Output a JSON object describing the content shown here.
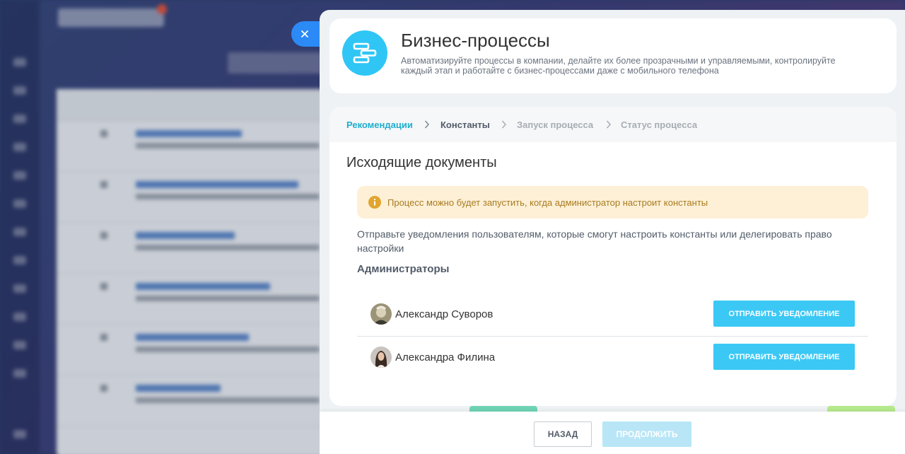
{
  "header": {
    "title": "Бизнес-процессы",
    "description": "Автоматизируйте процессы в компании, делайте их более прозрачными и управляемыми, контролируйте каждый этап и работайте с бизнес-процессами даже с мобильного телефона",
    "icon": "business-process-icon",
    "accent_color": "#2fc6f6"
  },
  "steps": [
    {
      "label": "Рекомендации",
      "state": "done"
    },
    {
      "label": "Константы",
      "state": "active"
    },
    {
      "label": "Запуск процесса",
      "state": "pending"
    },
    {
      "label": "Статус процесса",
      "state": "pending"
    }
  ],
  "section_title": "Исходящие документы",
  "alert": {
    "text": "Процесс можно будет запустить, когда администратор настроит константы",
    "icon": "info-icon",
    "color": "#e2a52e"
  },
  "info_text": "Отправьте уведомления пользователям, которые смогут настроить константы или делегировать право настройки",
  "admins": {
    "label": "Администраторы",
    "items": [
      {
        "name": "Александр Суворов",
        "button": "ОТПРАВИТЬ УВЕДОМЛЕНИЕ"
      },
      {
        "name": "Александра Филина",
        "button": "ОТПРАВИТЬ УВЕДОМЛЕНИЕ"
      }
    ]
  },
  "footer": {
    "back_label": "НАЗАД",
    "continue_label": "ПРОДОЛЖИТЬ"
  },
  "close_icon": "close-icon"
}
